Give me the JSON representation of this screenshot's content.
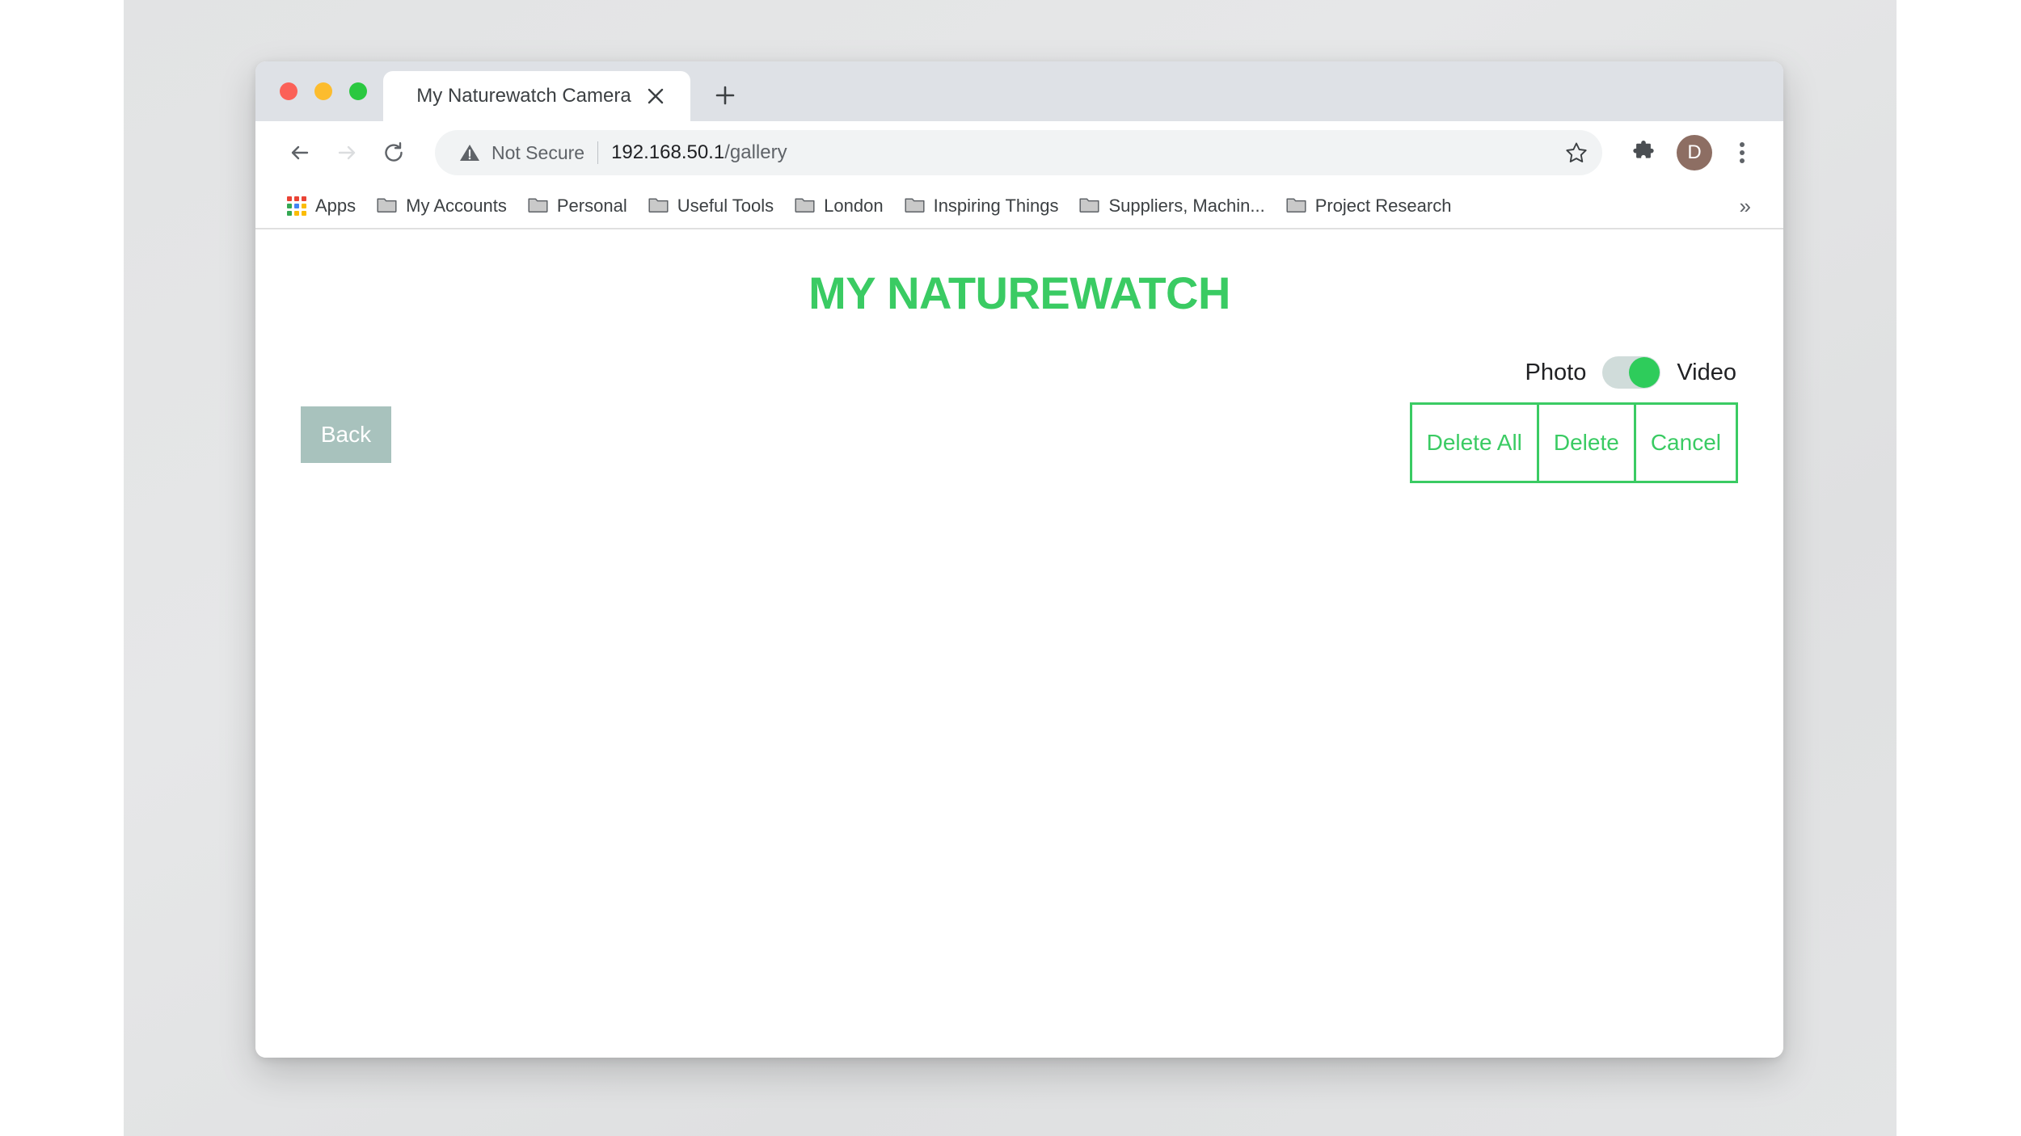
{
  "browser": {
    "traffic_lights": [
      "close",
      "minimize",
      "maximize"
    ],
    "tab": {
      "title": "My Naturewatch Camera",
      "close_icon": "close-icon"
    },
    "new_tab_label": "+",
    "nav": {
      "back_icon": "arrow-left-icon",
      "forward_icon": "arrow-right-icon",
      "reload_icon": "reload-icon"
    },
    "omnibox": {
      "security_label": "Not Secure",
      "security_icon": "warning-triangle-icon",
      "url_host": "192.168.50.1",
      "url_path": "/gallery",
      "star_icon": "bookmark-star-icon"
    },
    "toolbar_icons": {
      "extensions": "puzzle-piece-icon",
      "menu": "three-dot-menu-icon"
    },
    "profile": {
      "initial": "D"
    },
    "bookmarks": {
      "apps_label": "Apps",
      "items": [
        {
          "label": "My Accounts"
        },
        {
          "label": "Personal"
        },
        {
          "label": "Useful Tools"
        },
        {
          "label": "London"
        },
        {
          "label": "Inspiring Things"
        },
        {
          "label": "Suppliers, Machin..."
        },
        {
          "label": "Project Research"
        }
      ],
      "overflow_label": "»"
    }
  },
  "page": {
    "title": "MY NATUREWATCH",
    "mode_toggle": {
      "left_label": "Photo",
      "right_label": "Video",
      "state": "Video"
    },
    "back_button": "Back",
    "delete_buttons": [
      {
        "label": "Delete All"
      },
      {
        "label": "Delete"
      },
      {
        "label": "Cancel"
      }
    ]
  },
  "colors": {
    "brand_green": "#3ACB63",
    "toggle_knob": "#2ECC5B",
    "toggle_track": "#d0dcda",
    "back_button_bg": "#a8c2bd",
    "avatar_bg": "#8d6e63"
  }
}
